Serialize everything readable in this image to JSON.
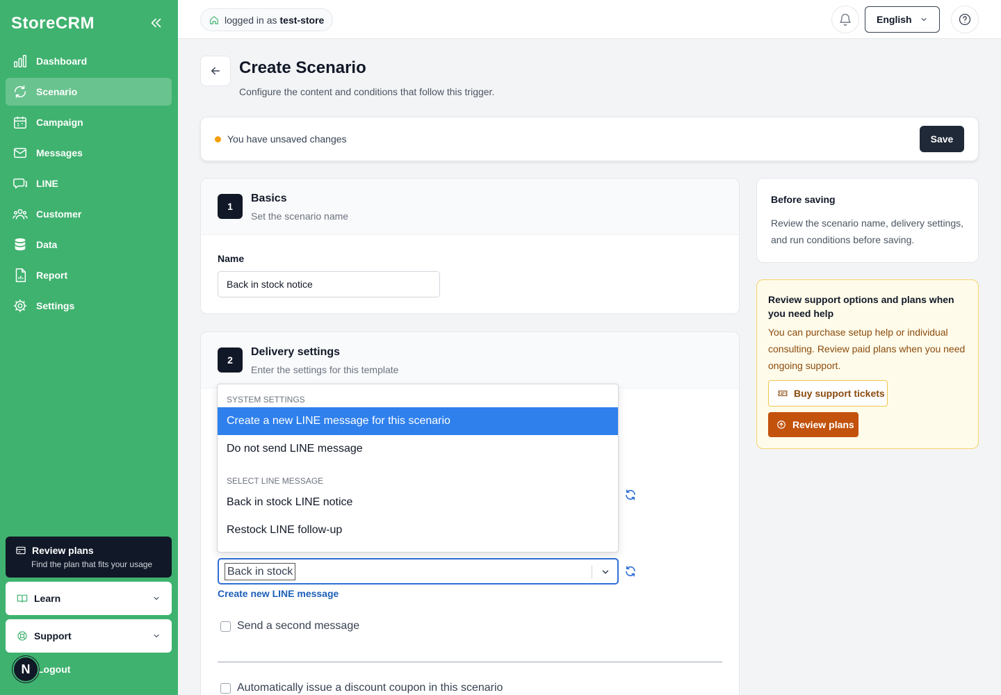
{
  "app": {
    "brand": "StoreCRM"
  },
  "sidebar": {
    "items": [
      {
        "label": "Dashboard",
        "icon": "bar-chart-icon"
      },
      {
        "label": "Scenario",
        "icon": "refresh-cycle-icon"
      },
      {
        "label": "Campaign",
        "icon": "calendar-icon"
      },
      {
        "label": "Messages",
        "icon": "mail-icon"
      },
      {
        "label": "LINE",
        "icon": "chat-bubble-icon"
      },
      {
        "label": "Customer",
        "icon": "users-icon"
      },
      {
        "label": "Data",
        "icon": "database-icon"
      },
      {
        "label": "Report",
        "icon": "document-chart-icon"
      },
      {
        "label": "Settings",
        "icon": "gear-icon"
      }
    ],
    "active_index": 1,
    "plan_card": {
      "title": "Review plans",
      "subtitle": "Find the plan that fits your usage"
    },
    "learn_label": "Learn",
    "support_label": "Support",
    "avatar_letter": "N",
    "logout_label": "Logout"
  },
  "topbar": {
    "login_prefix": "logged in as",
    "login_store": "test-store",
    "language": "English"
  },
  "header": {
    "title": "Create Scenario",
    "subtitle": "Configure the content and conditions that follow this trigger."
  },
  "unsaved_bar": {
    "message": "You have unsaved changes",
    "save_label": "Save",
    "status_color": "#f59e0b"
  },
  "basics": {
    "step": "1",
    "title": "Basics",
    "subtitle": "Set the scenario name",
    "name_label": "Name",
    "name_value": "Back in stock notice"
  },
  "delivery": {
    "step": "2",
    "title": "Delivery settings",
    "subtitle": "Enter the settings for this template",
    "select_value": "Back in stock",
    "create_link": "Create new LINE message",
    "second_message_label": "Send a second message",
    "coupon_label": "Automatically issue a discount coupon in this scenario"
  },
  "dropdown": {
    "group1": "System settings",
    "group1_options": [
      "Create a new LINE message for this scenario",
      "Do not send LINE message"
    ],
    "selected_option": "Create a new LINE message for this scenario",
    "group2": "Select LINE message",
    "group2_options": [
      "Back in stock LINE notice",
      "Restock LINE follow-up"
    ]
  },
  "before_saving": {
    "title": "Before saving",
    "body": "Review the scenario name, delivery settings, and run conditions before saving."
  },
  "support_panel": {
    "title": "Review support options and plans when you need help",
    "body": "You can purchase setup help or individual consulting. Review paid plans when you need ongoing support.",
    "tickets_label": "Buy support tickets",
    "plans_label": "Review plans",
    "accent_color": "#c2520c"
  },
  "colors": {
    "sidebar_green": "#3fb26f",
    "dark": "#111827",
    "link_blue": "#1d5fb8",
    "select_blue": "#2f80ed"
  }
}
